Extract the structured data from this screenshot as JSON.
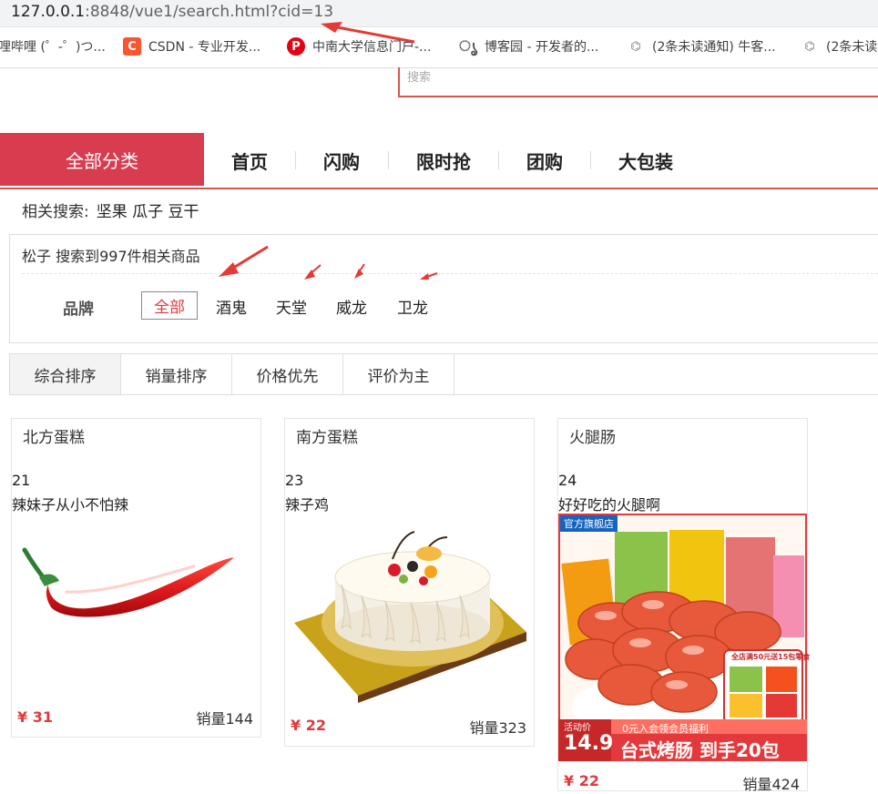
{
  "browser": {
    "url_host": "127.0.0.1",
    "url_rest": ":8848/vue1/search.html?cid=13",
    "bookmarks": [
      {
        "label": "哩哔哩 (゜-゜)つ...",
        "icon": "bilibili-icon"
      },
      {
        "label": "CSDN - 专业开发...",
        "icon": "csdn-icon"
      },
      {
        "label": "中南大学信息门户-...",
        "icon": "portal-icon"
      },
      {
        "label": "博客园 - 开发者的...",
        "icon": "cnblogs-icon"
      },
      {
        "label": "(2条未读通知) 牛客...",
        "icon": "nowcoder-icon"
      },
      {
        "label": "(2条未读",
        "icon": "nowcoder-icon"
      }
    ]
  },
  "search": {
    "placeholder": "搜索"
  },
  "nav": {
    "all_categories": "全部分类",
    "items": [
      "首页",
      "闪购",
      "限时抢",
      "团购",
      "大包装"
    ]
  },
  "related": {
    "label": "相关搜索:",
    "keywords": "坚果 瓜子 豆干"
  },
  "filter": {
    "result_text": "松子 搜索到997件相关商品",
    "brand_label": "品牌",
    "brands": [
      "全部",
      "酒鬼",
      "天堂",
      "威龙",
      "卫龙"
    ]
  },
  "sort": {
    "options": [
      "综合排序",
      "销量排序",
      "价格优先",
      "评价为主"
    ]
  },
  "products": [
    {
      "category": "北方蛋糕",
      "id": "21",
      "name": "辣妹子从小不怕辣",
      "price": "¥ 31",
      "sales": "销量144",
      "image": "chili-pepper"
    },
    {
      "category": "南方蛋糕",
      "id": "23",
      "name": "辣子鸡",
      "price": "¥ 22",
      "sales": "销量323",
      "image": "fruit-cake"
    },
    {
      "category": "火腿肠",
      "id": "24",
      "name": "好好吃的火腿啊",
      "price": "¥ 22",
      "sales": "销量424",
      "image": "sausage-package",
      "promo": {
        "store": "官方旗舰店",
        "badge": "活动价",
        "price": "14.9",
        "headline": "台式烤肠 到手20包",
        "sub": "0元入会领会员福利",
        "coupon": "全店满50元送15包零食"
      }
    }
  ],
  "colors": {
    "accent": "#d73d4f",
    "price": "#e4393c",
    "annotation_arrow": "#e53935"
  }
}
